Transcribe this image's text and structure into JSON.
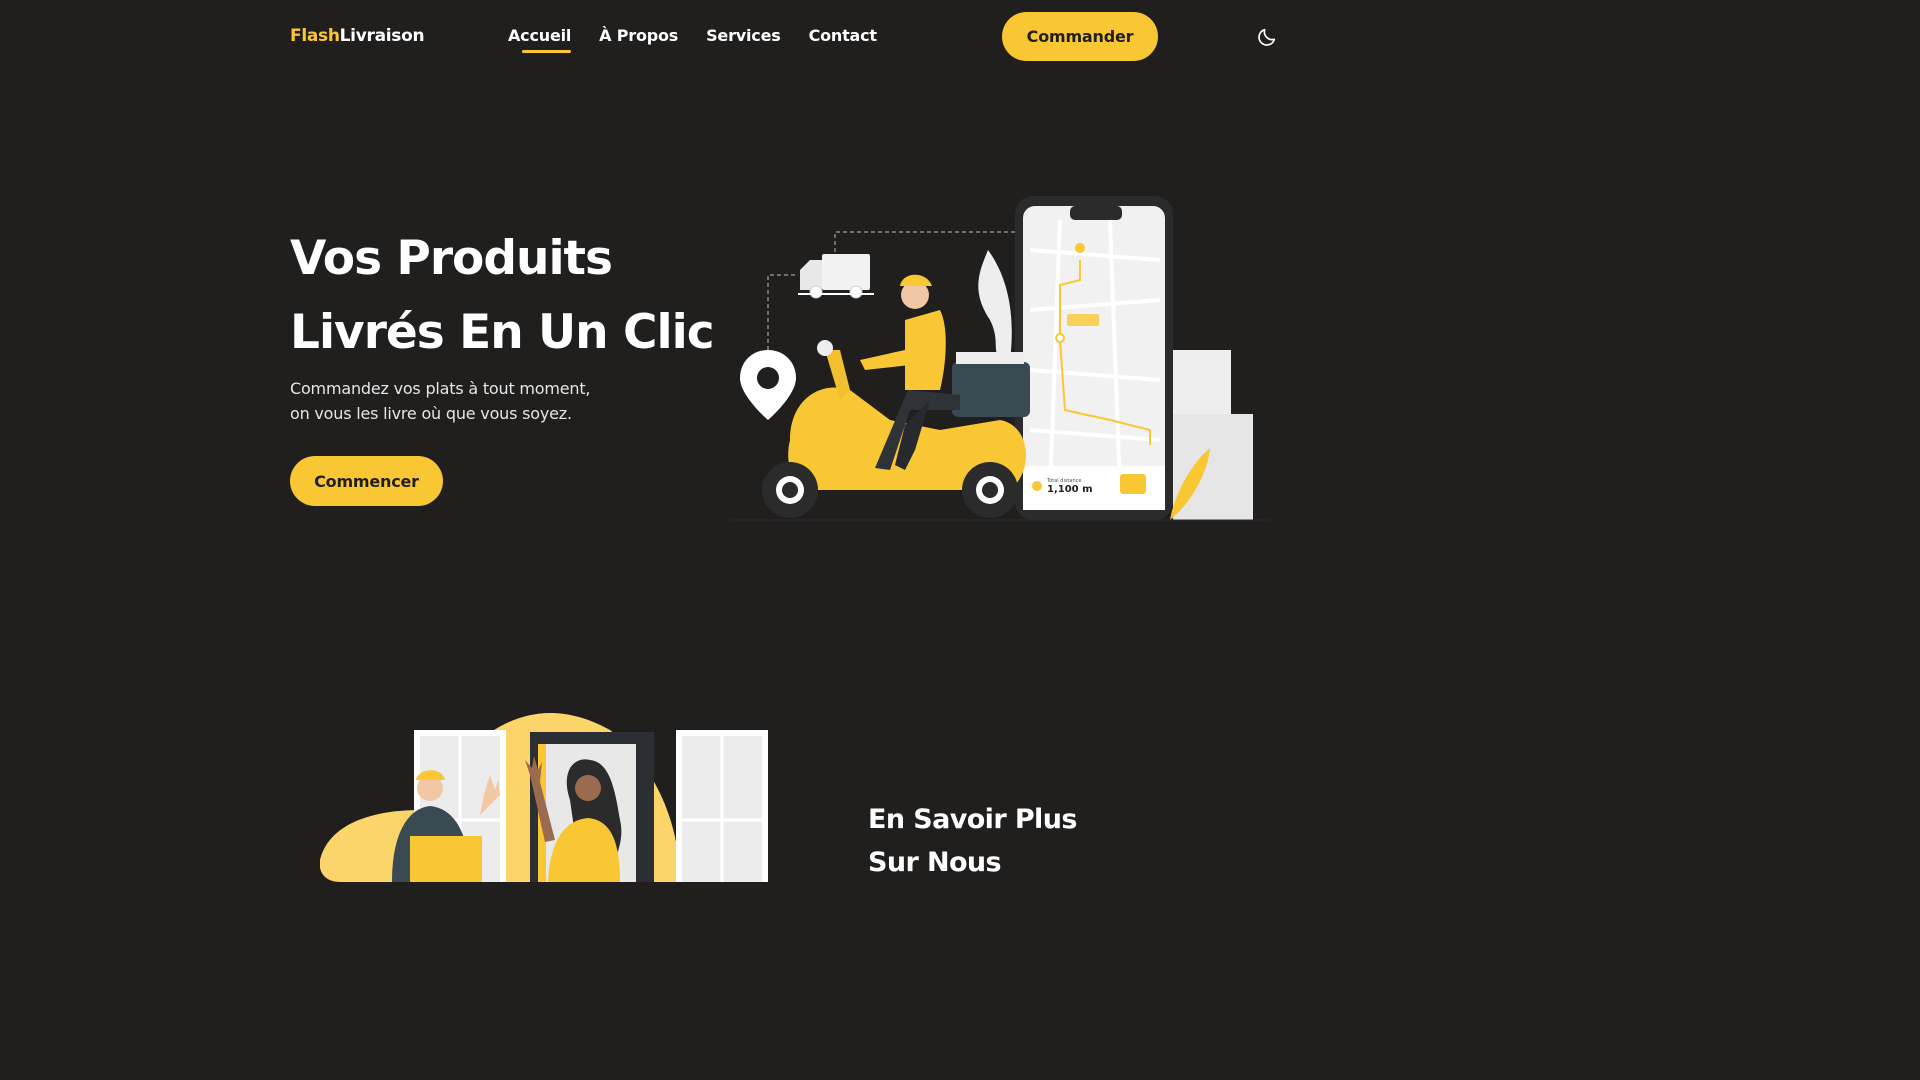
{
  "header": {
    "logo": {
      "part1": "Flash",
      "part2": "Livraison"
    },
    "nav": [
      {
        "label": "Accueil",
        "active": true
      },
      {
        "label": "À Propos",
        "active": false
      },
      {
        "label": "Services",
        "active": false
      },
      {
        "label": "Contact",
        "active": false
      }
    ],
    "cta_label": "Commander",
    "theme_icon": "moon-icon"
  },
  "hero": {
    "title_line1": "Vos Produits",
    "title_line2": "Livrés En Un Clic",
    "subtitle_line1": "Commandez vos plats à tout moment,",
    "subtitle_line2": "on vous les livre où que vous soyez.",
    "cta_label": "Commencer",
    "illustration": {
      "phone_distance_label": "Total distance",
      "phone_distance_value": "1,100 m"
    }
  },
  "about": {
    "title_line1": "En Savoir Plus",
    "title_line2": "Sur Nous"
  },
  "colors": {
    "background": "#211f1d",
    "accent": "#f9c733",
    "text": "#ffffff"
  }
}
